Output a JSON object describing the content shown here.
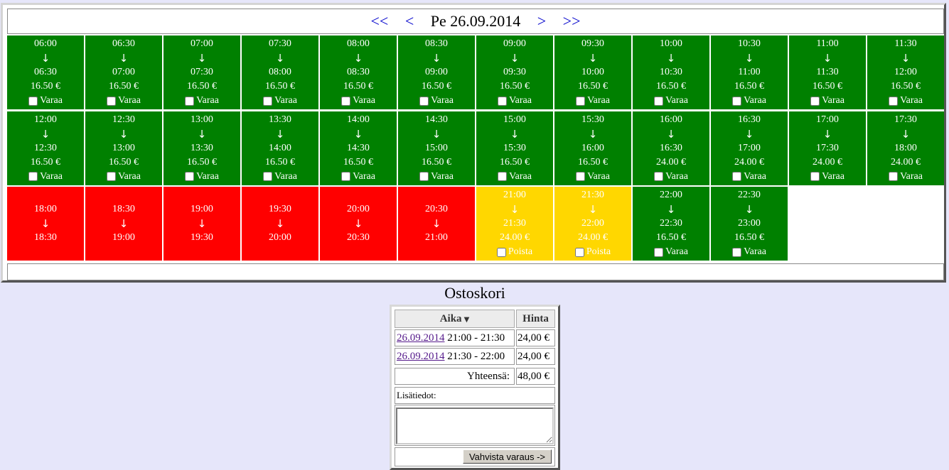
{
  "nav": {
    "prev_week": "<<",
    "prev_day": "<",
    "date_label": "Pe 26.09.2014",
    "next_day": ">",
    "next_week": ">>"
  },
  "arrow": "↓",
  "slots": [
    {
      "start": "06:00",
      "end": "06:30",
      "price": "16.50 €",
      "action": "Varaa",
      "status": "free"
    },
    {
      "start": "06:30",
      "end": "07:00",
      "price": "16.50 €",
      "action": "Varaa",
      "status": "free"
    },
    {
      "start": "07:00",
      "end": "07:30",
      "price": "16.50 €",
      "action": "Varaa",
      "status": "free"
    },
    {
      "start": "07:30",
      "end": "08:00",
      "price": "16.50 €",
      "action": "Varaa",
      "status": "free"
    },
    {
      "start": "08:00",
      "end": "08:30",
      "price": "16.50 €",
      "action": "Varaa",
      "status": "free"
    },
    {
      "start": "08:30",
      "end": "09:00",
      "price": "16.50 €",
      "action": "Varaa",
      "status": "free"
    },
    {
      "start": "09:00",
      "end": "09:30",
      "price": "16.50 €",
      "action": "Varaa",
      "status": "free"
    },
    {
      "start": "09:30",
      "end": "10:00",
      "price": "16.50 €",
      "action": "Varaa",
      "status": "free"
    },
    {
      "start": "10:00",
      "end": "10:30",
      "price": "16.50 €",
      "action": "Varaa",
      "status": "free"
    },
    {
      "start": "10:30",
      "end": "11:00",
      "price": "16.50 €",
      "action": "Varaa",
      "status": "free"
    },
    {
      "start": "11:00",
      "end": "11:30",
      "price": "16.50 €",
      "action": "Varaa",
      "status": "free"
    },
    {
      "start": "11:30",
      "end": "12:00",
      "price": "16.50 €",
      "action": "Varaa",
      "status": "free"
    },
    {
      "start": "12:00",
      "end": "12:30",
      "price": "16.50 €",
      "action": "Varaa",
      "status": "free"
    },
    {
      "start": "12:30",
      "end": "13:00",
      "price": "16.50 €",
      "action": "Varaa",
      "status": "free"
    },
    {
      "start": "13:00",
      "end": "13:30",
      "price": "16.50 €",
      "action": "Varaa",
      "status": "free"
    },
    {
      "start": "13:30",
      "end": "14:00",
      "price": "16.50 €",
      "action": "Varaa",
      "status": "free"
    },
    {
      "start": "14:00",
      "end": "14:30",
      "price": "16.50 €",
      "action": "Varaa",
      "status": "free"
    },
    {
      "start": "14:30",
      "end": "15:00",
      "price": "16.50 €",
      "action": "Varaa",
      "status": "free"
    },
    {
      "start": "15:00",
      "end": "15:30",
      "price": "16.50 €",
      "action": "Varaa",
      "status": "free"
    },
    {
      "start": "15:30",
      "end": "16:00",
      "price": "16.50 €",
      "action": "Varaa",
      "status": "free"
    },
    {
      "start": "16:00",
      "end": "16:30",
      "price": "24.00 €",
      "action": "Varaa",
      "status": "free"
    },
    {
      "start": "16:30",
      "end": "17:00",
      "price": "24.00 €",
      "action": "Varaa",
      "status": "free"
    },
    {
      "start": "17:00",
      "end": "17:30",
      "price": "24.00 €",
      "action": "Varaa",
      "status": "free"
    },
    {
      "start": "17:30",
      "end": "18:00",
      "price": "24.00 €",
      "action": "Varaa",
      "status": "free"
    },
    {
      "start": "18:00",
      "end": "18:30",
      "status": "busy"
    },
    {
      "start": "18:30",
      "end": "19:00",
      "status": "busy"
    },
    {
      "start": "19:00",
      "end": "19:30",
      "status": "busy"
    },
    {
      "start": "19:30",
      "end": "20:00",
      "status": "busy"
    },
    {
      "start": "20:00",
      "end": "20:30",
      "status": "busy"
    },
    {
      "start": "20:30",
      "end": "21:00",
      "status": "busy"
    },
    {
      "start": "21:00",
      "end": "21:30",
      "price": "24.00 €",
      "action": "Poista",
      "status": "mine"
    },
    {
      "start": "21:30",
      "end": "22:00",
      "price": "24.00 €",
      "action": "Poista",
      "status": "mine"
    },
    {
      "start": "22:00",
      "end": "22:30",
      "price": "16.50 €",
      "action": "Varaa",
      "status": "free"
    },
    {
      "start": "22:30",
      "end": "23:00",
      "price": "16.50 €",
      "action": "Varaa",
      "status": "free"
    }
  ],
  "colors": {
    "free": "#008000",
    "busy": "#ff0000",
    "mine": "#ffd700",
    "background": "#e6e6fa"
  },
  "cart": {
    "title": "Ostoskori",
    "col_time": "Aika",
    "col_price": "Hinta",
    "items": [
      {
        "date": "26.09.2014",
        "time": "21:00 - 21:30",
        "price": "24,00 €"
      },
      {
        "date": "26.09.2014",
        "time": "21:30 - 22:00",
        "price": "24,00 €"
      }
    ],
    "total_label": "Yhteensä:",
    "total": "48,00 €",
    "notes_label": "Lisätiedot:",
    "notes_value": "",
    "confirm_label": "Vahvista varaus ->"
  }
}
